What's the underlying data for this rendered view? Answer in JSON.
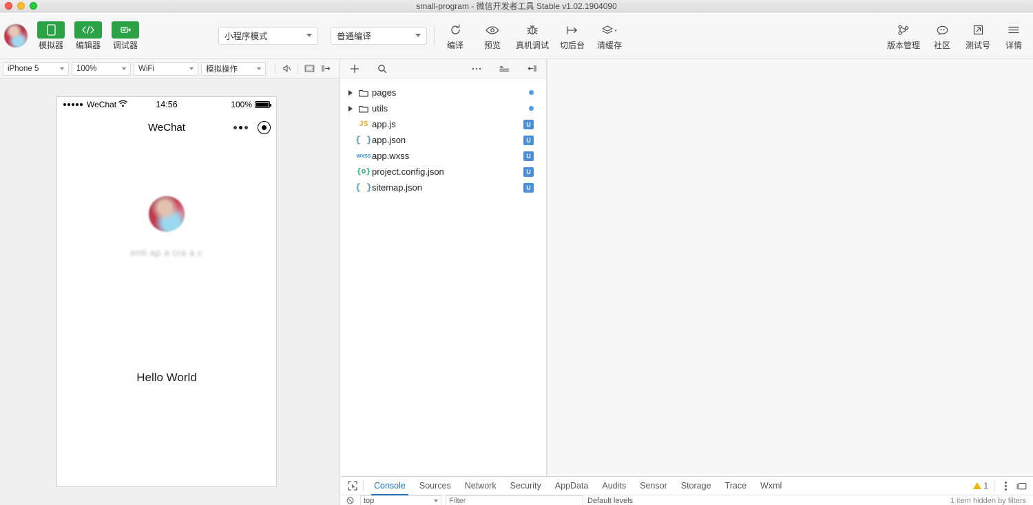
{
  "window": {
    "title": "small-program - 微信开发者工具 Stable v1.02.1904090"
  },
  "toolbar": {
    "panels": [
      {
        "label": "模拟器",
        "icon": "phone-icon",
        "active": true
      },
      {
        "label": "编辑器",
        "icon": "code-icon",
        "active": true
      },
      {
        "label": "调试器",
        "icon": "debug-icon",
        "active": true
      }
    ],
    "mode_select": {
      "value": "小程序模式"
    },
    "compile_select": {
      "value": "普通编译"
    },
    "actions": [
      {
        "label": "编译",
        "icon": "refresh-icon"
      },
      {
        "label": "预览",
        "icon": "eye-icon"
      },
      {
        "label": "真机调试",
        "icon": "bug-icon"
      },
      {
        "label": "切后台",
        "icon": "background-icon"
      },
      {
        "label": "清缓存",
        "icon": "layers-icon"
      }
    ],
    "right_actions": [
      {
        "label": "版本管理",
        "icon": "branch-icon"
      },
      {
        "label": "社区",
        "icon": "chat-icon"
      },
      {
        "label": "测试号",
        "icon": "external-link-icon"
      },
      {
        "label": "详情",
        "icon": "menu-icon"
      }
    ]
  },
  "simulator": {
    "device_select": {
      "value": "iPhone 5"
    },
    "zoom_select": {
      "value": "100%"
    },
    "network_select": {
      "value": "WiFi"
    },
    "action_select": {
      "value": "模拟操作"
    },
    "icons": [
      "mute-icon",
      "screen-icon",
      "collapse-right-icon"
    ],
    "phone": {
      "status_bar": {
        "carrier": "WeChat",
        "signal_dots": 5,
        "time": "14:56",
        "battery_text": "100%"
      },
      "nav_bar": {
        "title": "WeChat",
        "capsule": [
          "more-dots-icon",
          "target-icon"
        ]
      },
      "content": {
        "avatar": "user-avatar",
        "username": "enti ap a cra a c",
        "hello_text": "Hello World"
      }
    }
  },
  "explorer": {
    "toolbar_icons": [
      "add-icon",
      "search-icon",
      "more-icon",
      "outline-icon",
      "collapse-left-icon"
    ],
    "tree": [
      {
        "name": "pages",
        "type": "folder",
        "icon": "folder-icon",
        "expanded": false,
        "status": "dot"
      },
      {
        "name": "utils",
        "type": "folder",
        "icon": "folder-icon",
        "expanded": false,
        "status": "dot"
      },
      {
        "name": "app.js",
        "type": "file",
        "icon": "js-icon",
        "badge": "U"
      },
      {
        "name": "app.json",
        "type": "file",
        "icon": "json-icon",
        "badge": "U"
      },
      {
        "name": "app.wxss",
        "type": "file",
        "icon": "wxss-icon",
        "badge": "U"
      },
      {
        "name": "project.config.json",
        "type": "file",
        "icon": "config-icon",
        "badge": "U"
      },
      {
        "name": "sitemap.json",
        "type": "file",
        "icon": "json-icon",
        "badge": "U"
      }
    ]
  },
  "devtools": {
    "inspect_icon": "inspect-element-icon",
    "tabs": [
      {
        "label": "Console",
        "selected": true
      },
      {
        "label": "Sources",
        "selected": false
      },
      {
        "label": "Network",
        "selected": false
      },
      {
        "label": "Security",
        "selected": false
      },
      {
        "label": "AppData",
        "selected": false
      },
      {
        "label": "Audits",
        "selected": false
      },
      {
        "label": "Sensor",
        "selected": false
      },
      {
        "label": "Storage",
        "selected": false
      },
      {
        "label": "Trace",
        "selected": false
      },
      {
        "label": "Wxml",
        "selected": false
      }
    ],
    "warning_count": "1",
    "console": {
      "context": "top",
      "filter_placeholder": "Filter",
      "levels": "Default levels",
      "hidden_note": "1 item hidden by filters"
    }
  },
  "colors": {
    "accent_green": "#2ba245",
    "badge_blue": "#4a90d9",
    "dot_blue": "#4a9eea",
    "tab_blue": "#1a73c8",
    "warning_yellow": "#f0b400"
  }
}
